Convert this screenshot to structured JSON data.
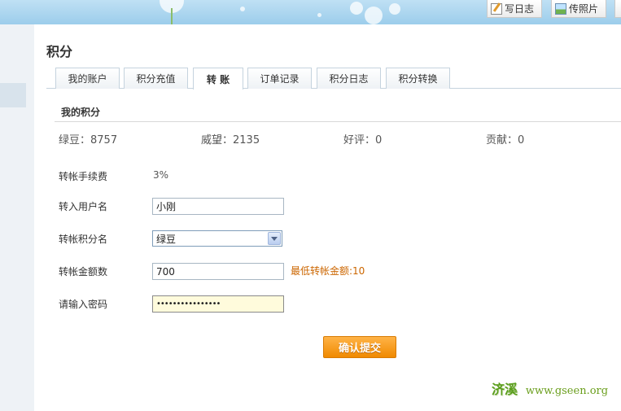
{
  "toolbar": {
    "write_blog": "写日志",
    "upload_photo": "传照片"
  },
  "page": {
    "title": "积分"
  },
  "tabs": [
    {
      "label": "我的账户"
    },
    {
      "label": "积分充值"
    },
    {
      "label": "转 账",
      "active": true
    },
    {
      "label": "订单记录"
    },
    {
      "label": "积分日志"
    },
    {
      "label": "积分转换"
    }
  ],
  "my_points": {
    "title": "我的积分",
    "stats": [
      {
        "text": "绿豆：8757"
      },
      {
        "text": "威望：2135"
      },
      {
        "text": "好评：0"
      },
      {
        "text": "贡献：0"
      }
    ]
  },
  "form": {
    "fee_label": "转帐手续费",
    "fee_value": "3%",
    "user_label": "转入用户名",
    "user_value": "小刚",
    "points_label": "转帐积分名",
    "points_value": "绿豆",
    "amount_label": "转帐金额数",
    "amount_value": "700",
    "amount_hint": "最低转帐金额:10",
    "password_label": "请输入密码",
    "password_value": "••••••••••••••••",
    "submit_label": "确认提交"
  },
  "watermark": {
    "cn": "济溪",
    "url": "www.gseen.org"
  },
  "colors": {
    "accent_orange": "#f08a00",
    "hint_orange": "#cc6600",
    "tab_border": "#c5d3de"
  }
}
